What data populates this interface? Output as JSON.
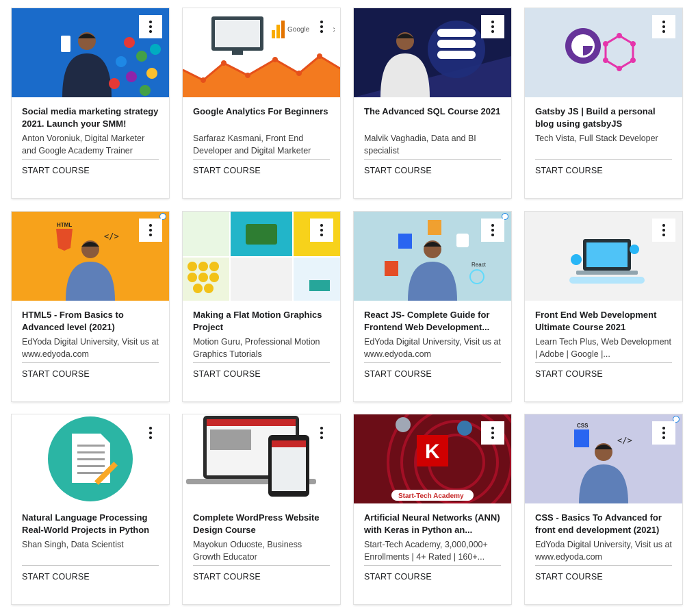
{
  "courses": [
    {
      "title": "Social media marketing strategy 2021. Launch your SMM!",
      "author": "Anton Voroniuk, Digital Marketer and Google Academy Trainer",
      "cta": "START COURSE",
      "thumb_bg": "#1565c0"
    },
    {
      "title": "Google Analytics For Beginners",
      "author": "Sarfaraz Kasmani, Front End Developer and Digital Marketer",
      "cta": "START COURSE",
      "thumb_bg": "#ffffff",
      "thumb_text": "Google Analytic"
    },
    {
      "title": "The Advanced SQL Course 2021",
      "author": "Malvik Vaghadia, Data and BI specialist",
      "cta": "START COURSE",
      "thumb_bg": "#141a4a"
    },
    {
      "title": "Gatsby JS | Build a personal blog using gatsbyJS",
      "author": "Tech Vista, Full Stack Developer",
      "cta": "START COURSE",
      "thumb_bg": "#d7e3ee"
    },
    {
      "title": "HTML5 - From Basics to Advanced level (2021)",
      "author": "EdYoda Digital University, Visit us at www.edyoda.com",
      "cta": "START COURSE",
      "thumb_bg": "#f7a21b",
      "thumb_text": "HTML"
    },
    {
      "title": "Making a Flat Motion Graphics Project",
      "author": "Motion Guru, Professional Motion Graphics Tutorials",
      "cta": "START COURSE",
      "thumb_bg": "#ffffff"
    },
    {
      "title": "React JS- Complete Guide for Frontend Web Development...",
      "author": "EdYoda Digital University, Visit us at www.edyoda.com",
      "cta": "START COURSE",
      "thumb_bg": "#b9dbe4",
      "thumb_text": "React"
    },
    {
      "title": "Front End Web Development Ultimate Course 2021",
      "author": "Learn Tech Plus, Web Development | Adobe | Google |...",
      "cta": "START COURSE",
      "thumb_bg": "#f2f2f2"
    },
    {
      "title": "Natural Language Processing Real-World Projects in Python",
      "author": "Shan Singh, Data Scientist",
      "cta": "START COURSE",
      "thumb_bg": "#ffffff"
    },
    {
      "title": "Complete WordPress Website Design Course",
      "author": "Mayokun Oduoste, Business Growth Educator",
      "cta": "START COURSE",
      "thumb_bg": "#ffffff"
    },
    {
      "title": "Artificial Neural Networks (ANN) with Keras in Python an...",
      "author": "Start-Tech Academy, 3,000,000+ Enrollments | 4+ Rated | 160+...",
      "cta": "START COURSE",
      "thumb_bg": "#6b0d17",
      "thumb_text": "Start-Tech Academy"
    },
    {
      "title": "CSS - Basics To Advanced for front end development (2021)",
      "author": "EdYoda Digital University, Visit us at www.edyoda.com",
      "cta": "START COURSE",
      "thumb_bg": "#c9cbe6",
      "thumb_text": "CSS"
    }
  ]
}
